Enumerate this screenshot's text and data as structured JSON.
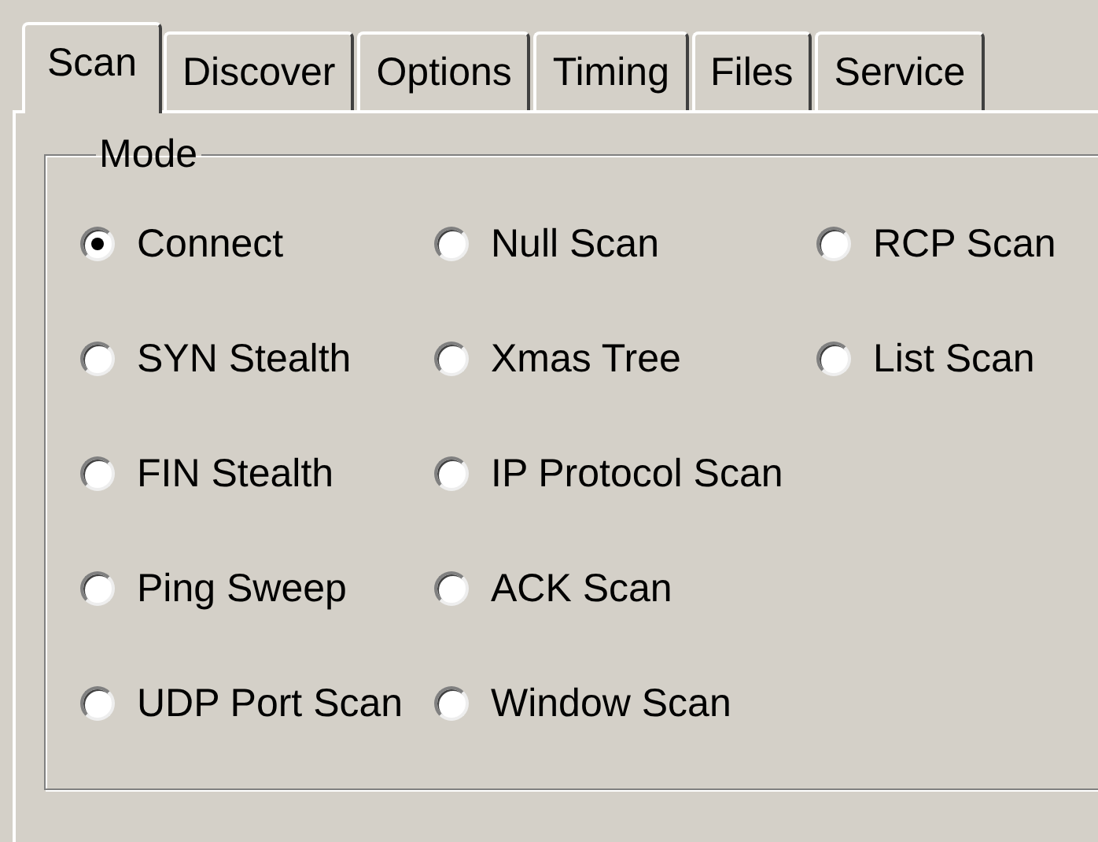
{
  "tabs": [
    {
      "label": "Scan",
      "selected": true
    },
    {
      "label": "Discover",
      "selected": false
    },
    {
      "label": "Options",
      "selected": false
    },
    {
      "label": "Timing",
      "selected": false
    },
    {
      "label": "Files",
      "selected": false
    },
    {
      "label": "Service",
      "selected": false
    }
  ],
  "mode_group": {
    "title": "Mode",
    "options": [
      {
        "label": "Connect",
        "selected": true
      },
      {
        "label": "SYN Stealth",
        "selected": false
      },
      {
        "label": "FIN Stealth",
        "selected": false
      },
      {
        "label": "Ping Sweep",
        "selected": false
      },
      {
        "label": "UDP Port Scan",
        "selected": false
      },
      {
        "label": "Null Scan",
        "selected": false
      },
      {
        "label": "Xmas Tree",
        "selected": false
      },
      {
        "label": "IP Protocol Scan",
        "selected": false
      },
      {
        "label": "ACK Scan",
        "selected": false
      },
      {
        "label": "Window Scan",
        "selected": false
      },
      {
        "label": "RCP Scan",
        "selected": false
      },
      {
        "label": "List Scan",
        "selected": false
      }
    ]
  }
}
